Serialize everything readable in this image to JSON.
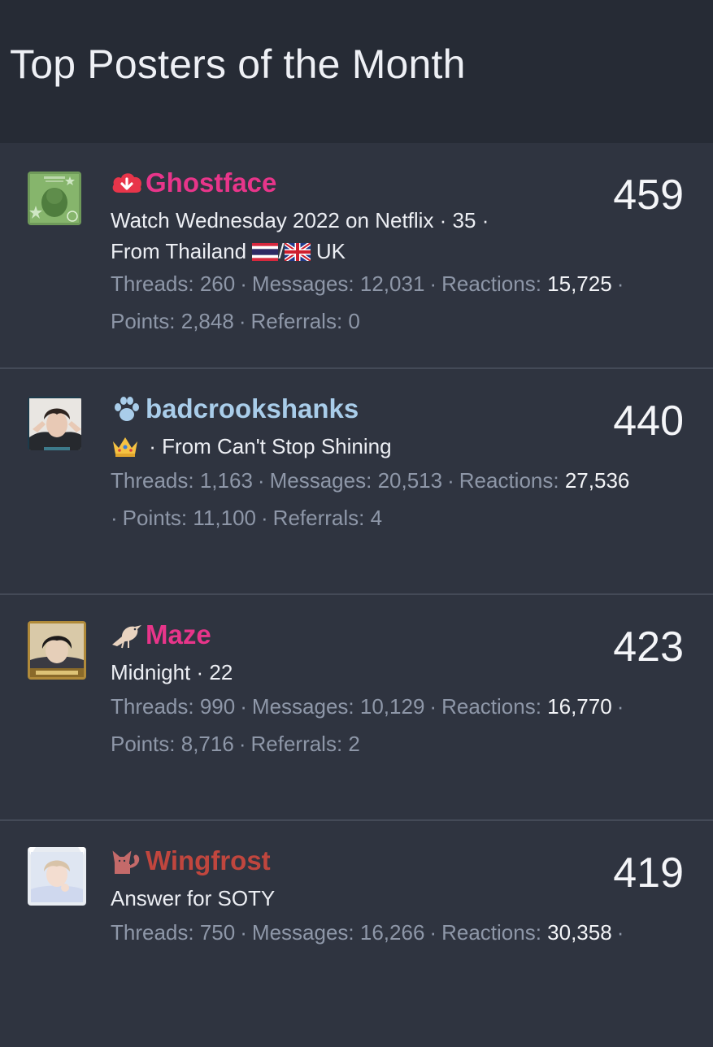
{
  "header": {
    "title": "Top Posters of the Month"
  },
  "labels": {
    "threads": "Threads:",
    "messages": "Messages:",
    "reactions": "Reactions:",
    "points": "Points:",
    "referrals": "Referrals:"
  },
  "posters": [
    {
      "username": "Ghostface",
      "name_color": "#e8358a",
      "name_icon": "cloud-download-icon",
      "icon_color": "#e8354a",
      "desc_line1": "Watch Wednesday 2022 on Netflix · 35 ·",
      "desc_line2_prefix": "From Thailand",
      "desc_line2_sep": "/",
      "desc_line2_suffix": "UK",
      "threads": "260",
      "messages": "12,031",
      "reactions": "15,725",
      "points": "2,848",
      "referrals": "0",
      "count": "459"
    },
    {
      "username": "badcrookshanks",
      "name_color": "#a9cdea",
      "name_icon": "paw-icon",
      "icon_color": "#a9cdea",
      "desc_line1": "· From Can't Stop Shining",
      "threads": "1,163",
      "messages": "20,513",
      "reactions": "27,536",
      "points": "11,100",
      "referrals": "4",
      "count": "440"
    },
    {
      "username": "Maze",
      "name_color": "#e8358a",
      "name_icon": "bird-icon",
      "icon_color": "#e9d3c0",
      "desc_line1": "Midnight · 22",
      "threads": "990",
      "messages": "10,129",
      "reactions": "16,770",
      "points": "8,716",
      "referrals": "2",
      "count": "423"
    },
    {
      "username": "Wingfrost",
      "name_color": "#c0463e",
      "name_icon": "cat-icon",
      "icon_color": "#c46a6a",
      "desc_line1": "Answer for SOTY",
      "threads": "750",
      "messages": "16,266",
      "reactions": "30,358",
      "count": "419"
    }
  ]
}
